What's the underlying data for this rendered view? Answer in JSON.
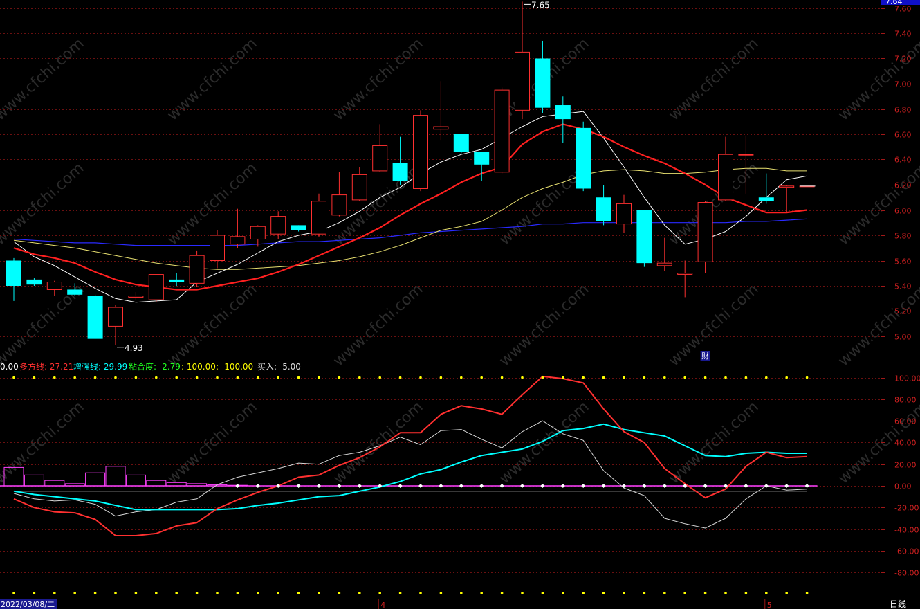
{
  "colors": {
    "background": "#000000",
    "frame": "#a01818",
    "grid": "#6a1010",
    "up": "#ff3030",
    "down": "#00ffff",
    "ma_white": "#ffffff",
    "ma_red": "#ff2020",
    "ma_yellow": "#e8e070",
    "ma_blue": "#2a2aff",
    "axis_text": "#d02020",
    "dot": "#ffff00",
    "magenta": "#ff40ff"
  },
  "watermark": "www.cfchi.com",
  "chart_data": [
    {
      "type": "candlestick",
      "title": "",
      "ylim": [
        4.8,
        7.65
      ],
      "y_ticks": [
        "5.00",
        "5.20",
        "5.40",
        "5.60",
        "5.80",
        "6.00",
        "6.20",
        "6.40",
        "6.60",
        "6.80",
        "7.00",
        "7.20",
        "7.40",
        "7.60"
      ],
      "current_price_tag": "7.64",
      "annotations": {
        "high": "7.65",
        "low": "4.93",
        "finance_marker": "财"
      },
      "candles": [
        {
          "o": 5.6,
          "h": 5.62,
          "l": 5.28,
          "c": 5.4
        },
        {
          "o": 5.45,
          "h": 5.46,
          "l": 5.4,
          "c": 5.41
        },
        {
          "o": 5.37,
          "h": 5.44,
          "l": 5.32,
          "c": 5.43
        },
        {
          "o": 5.37,
          "h": 5.42,
          "l": 5.32,
          "c": 5.33
        },
        {
          "o": 5.32,
          "h": 5.33,
          "l": 4.98,
          "c": 4.98
        },
        {
          "o": 5.08,
          "h": 5.25,
          "l": 4.93,
          "c": 5.23
        },
        {
          "o": 5.31,
          "h": 5.35,
          "l": 5.29,
          "c": 5.32
        },
        {
          "o": 5.29,
          "h": 5.49,
          "l": 5.27,
          "c": 5.49
        },
        {
          "o": 5.45,
          "h": 5.5,
          "l": 5.4,
          "c": 5.43
        },
        {
          "o": 5.42,
          "h": 5.68,
          "l": 5.39,
          "c": 5.64
        },
        {
          "o": 5.6,
          "h": 5.84,
          "l": 5.54,
          "c": 5.8
        },
        {
          "o": 5.73,
          "h": 6.01,
          "l": 5.7,
          "c": 5.79
        },
        {
          "o": 5.77,
          "h": 5.88,
          "l": 5.71,
          "c": 5.87
        },
        {
          "o": 5.81,
          "h": 5.99,
          "l": 5.77,
          "c": 5.95
        },
        {
          "o": 5.88,
          "h": 5.88,
          "l": 5.83,
          "c": 5.84
        },
        {
          "o": 5.81,
          "h": 6.13,
          "l": 5.79,
          "c": 6.07
        },
        {
          "o": 5.96,
          "h": 6.3,
          "l": 5.95,
          "c": 6.12
        },
        {
          "o": 6.08,
          "h": 6.34,
          "l": 6.07,
          "c": 6.28
        },
        {
          "o": 6.31,
          "h": 6.68,
          "l": 6.3,
          "c": 6.51
        },
        {
          "o": 6.37,
          "h": 6.58,
          "l": 6.2,
          "c": 6.23
        },
        {
          "o": 6.17,
          "h": 6.79,
          "l": 6.15,
          "c": 6.75
        },
        {
          "o": 6.64,
          "h": 7.02,
          "l": 6.55,
          "c": 6.66
        },
        {
          "o": 6.6,
          "h": 6.6,
          "l": 6.45,
          "c": 6.46
        },
        {
          "o": 6.46,
          "h": 6.46,
          "l": 6.23,
          "c": 6.36
        },
        {
          "o": 6.3,
          "h": 6.97,
          "l": 6.29,
          "c": 6.95
        },
        {
          "o": 6.79,
          "h": 7.65,
          "l": 6.72,
          "c": 7.25
        },
        {
          "o": 7.2,
          "h": 7.34,
          "l": 6.77,
          "c": 6.81
        },
        {
          "o": 6.83,
          "h": 6.9,
          "l": 6.53,
          "c": 6.72
        },
        {
          "o": 6.65,
          "h": 6.7,
          "l": 6.15,
          "c": 6.17
        },
        {
          "o": 6.1,
          "h": 6.2,
          "l": 5.88,
          "c": 5.91
        },
        {
          "o": 5.89,
          "h": 6.12,
          "l": 5.82,
          "c": 6.05
        },
        {
          "o": 6.0,
          "h": 6.0,
          "l": 5.55,
          "c": 5.58
        },
        {
          "o": 5.56,
          "h": 5.78,
          "l": 5.52,
          "c": 5.58
        },
        {
          "o": 5.49,
          "h": 5.6,
          "l": 5.31,
          "c": 5.5
        },
        {
          "o": 5.59,
          "h": 6.07,
          "l": 5.5,
          "c": 6.06
        },
        {
          "o": 6.08,
          "h": 6.58,
          "l": 6.07,
          "c": 6.44
        },
        {
          "o": 6.44,
          "h": 6.59,
          "l": 6.13,
          "c": 6.44
        },
        {
          "o": 6.1,
          "h": 6.29,
          "l": 6.05,
          "c": 6.07
        },
        {
          "o": 6.18,
          "h": 6.2,
          "l": 5.98,
          "c": 6.19
        },
        {
          "o": 6.19,
          "h": 6.19,
          "l": 6.19,
          "c": 6.19
        }
      ],
      "ma_white": [
        5.75,
        5.63,
        5.56,
        5.47,
        5.38,
        5.3,
        5.27,
        5.28,
        5.29,
        5.43,
        5.5,
        5.57,
        5.66,
        5.75,
        5.8,
        5.83,
        5.9,
        5.99,
        6.1,
        6.18,
        6.29,
        6.38,
        6.44,
        6.48,
        6.57,
        6.66,
        6.74,
        6.76,
        6.78,
        6.57,
        6.34,
        6.1,
        5.88,
        5.73,
        5.77,
        5.83,
        5.95,
        6.1,
        6.24,
        6.27
      ],
      "ma_red": [
        5.7,
        5.65,
        5.62,
        5.58,
        5.51,
        5.45,
        5.41,
        5.39,
        5.37,
        5.37,
        5.4,
        5.43,
        5.46,
        5.51,
        5.57,
        5.64,
        5.71,
        5.78,
        5.86,
        5.96,
        6.05,
        6.13,
        6.22,
        6.29,
        6.34,
        6.52,
        6.62,
        6.68,
        6.64,
        6.58,
        6.5,
        6.43,
        6.37,
        6.29,
        6.2,
        6.1,
        6.04,
        5.98,
        5.98,
        6.0
      ],
      "ma_yellow": [
        5.76,
        5.74,
        5.72,
        5.7,
        5.67,
        5.64,
        5.61,
        5.58,
        5.56,
        5.54,
        5.53,
        5.53,
        5.54,
        5.55,
        5.56,
        5.58,
        5.6,
        5.63,
        5.67,
        5.72,
        5.78,
        5.84,
        5.87,
        5.91,
        6.0,
        6.1,
        6.17,
        6.22,
        6.28,
        6.31,
        6.32,
        6.31,
        6.29,
        6.29,
        6.3,
        6.32,
        6.33,
        6.33,
        6.31,
        6.31
      ],
      "ma_blue": [
        5.77,
        5.76,
        5.75,
        5.74,
        5.74,
        5.73,
        5.72,
        5.72,
        5.72,
        5.72,
        5.72,
        5.72,
        5.73,
        5.74,
        5.75,
        5.75,
        5.76,
        5.77,
        5.78,
        5.8,
        5.82,
        5.83,
        5.84,
        5.85,
        5.86,
        5.87,
        5.89,
        5.89,
        5.9,
        5.9,
        5.9,
        5.9,
        5.9,
        5.9,
        5.9,
        5.9,
        5.91,
        5.91,
        5.92,
        5.93
      ]
    },
    {
      "type": "line",
      "title": "",
      "ylim": [
        -110,
        110
      ],
      "y_ticks": [
        "100.00",
        "80.00",
        "60.00",
        "40.00",
        "20.00",
        "0.00",
        "-20.00",
        "-40.00",
        "-60.00",
        "-80.00"
      ],
      "header": [
        {
          "label": "0.00",
          "color": "#ffffff"
        },
        {
          "label": "多方线: 27.21",
          "color": "#ff3030"
        },
        {
          "label": "增强线: 29.99",
          "color": "#00ffff"
        },
        {
          "label": "粘合度: -2.79",
          "color": "#20ff20"
        },
        {
          "label": ": 100.00",
          "color": "#ffff00"
        },
        {
          "label": ": -100.00",
          "color": "#ffff00"
        },
        {
          "label": "买入: -5.00",
          "color": "#dddddd"
        }
      ],
      "series": [
        {
          "name": "多方线",
          "values": [
            -12,
            -20,
            -24,
            -25,
            -31,
            -46,
            -46,
            -44,
            -37,
            -34,
            -21,
            -13,
            -6,
            0,
            8,
            10,
            19,
            26,
            36,
            49,
            49,
            66,
            74,
            71,
            66,
            84,
            101,
            99,
            95,
            71,
            50,
            40,
            16,
            2,
            -11,
            -3,
            18,
            31,
            26,
            27
          ]
        },
        {
          "name": "增强线",
          "values": [
            -5,
            -8,
            -10,
            -12,
            -14,
            -18,
            -22,
            -22,
            -22,
            -22,
            -22,
            -21,
            -18,
            -16,
            -13,
            -10,
            -9,
            -5,
            -1,
            4,
            11,
            15,
            22,
            28,
            31,
            34,
            41,
            51,
            53,
            57,
            52,
            49,
            46,
            37,
            28,
            27,
            30,
            31,
            30,
            30
          ]
        },
        {
          "name": "粘合度",
          "values": [
            -7,
            -12,
            -14,
            -13,
            -17,
            -28,
            -24,
            -22,
            -15,
            -12,
            1,
            8,
            12,
            16,
            21,
            20,
            28,
            31,
            37,
            45,
            38,
            51,
            52,
            43,
            35,
            50,
            60,
            48,
            42,
            14,
            -2,
            -9,
            -30,
            -35,
            -39,
            -30,
            -12,
            0,
            -4,
            -3
          ]
        },
        {
          "name": "买入",
          "values": [
            -5,
            -5,
            -5,
            -5,
            -5,
            -5,
            -5,
            -5,
            -5,
            -5,
            -5,
            -5,
            -5,
            -5,
            -5,
            -5,
            -5,
            -5,
            -5,
            -5,
            -5,
            -5,
            -5,
            -5,
            -5,
            -5,
            -5,
            -5,
            -5,
            -5,
            -5,
            -5,
            -5,
            -5,
            -5,
            -5,
            -5,
            -5,
            -5,
            -5
          ]
        },
        {
          "name": "magenta",
          "values": [
            17,
            10,
            5,
            2,
            12,
            18,
            10,
            5,
            3,
            2,
            1,
            0.5,
            0.2,
            0,
            0,
            0,
            0,
            0,
            0,
            0,
            0,
            0,
            0,
            0,
            0,
            0,
            0,
            0,
            0,
            0,
            0,
            0,
            0,
            0,
            0,
            0,
            0,
            0,
            0,
            0
          ]
        }
      ]
    }
  ],
  "x_axis": {
    "date_label": "2022/03/08/二",
    "month_marks": [
      {
        "label": "4",
        "index": 18
      },
      {
        "label": "5",
        "index": 37
      }
    ],
    "period": "日线"
  }
}
